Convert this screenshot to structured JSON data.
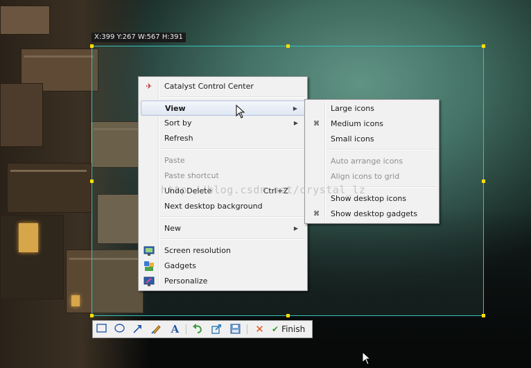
{
  "selection": {
    "coordinates": "X:399 Y:267 W:567 H:391"
  },
  "context_menu": {
    "items": [
      {
        "label": "Catalyst Control Center",
        "icon": "catalyst-icon"
      },
      {
        "label": "View",
        "submenu": true,
        "highlighted": true
      },
      {
        "label": "Sort by",
        "submenu": true
      },
      {
        "label": "Refresh"
      },
      {
        "label": "Paste",
        "disabled": true
      },
      {
        "label": "Paste shortcut",
        "disabled": true
      },
      {
        "label": "Undo Delete",
        "shortcut": "Ctrl+Z"
      },
      {
        "label": "Next desktop background"
      },
      {
        "label": "New",
        "submenu": true
      },
      {
        "label": "Screen resolution",
        "icon": "monitor-icon"
      },
      {
        "label": "Gadgets",
        "icon": "gadgets-icon"
      },
      {
        "label": "Personalize",
        "icon": "personalize-icon"
      }
    ]
  },
  "view_submenu": {
    "items": [
      {
        "label": "Large icons"
      },
      {
        "label": "Medium icons",
        "checked": true
      },
      {
        "label": "Small icons"
      },
      {
        "label": "Auto arrange icons",
        "disabled": true
      },
      {
        "label": "Align icons to grid",
        "disabled": true
      },
      {
        "label": "Show desktop icons"
      },
      {
        "label": "Show desktop gadgets",
        "checked": true
      }
    ]
  },
  "watermark": "http://blog.csdn.net/crystal_lz",
  "toolbar": {
    "tools": [
      "rectangle-icon",
      "ellipse-icon",
      "arrow-icon",
      "brush-icon",
      "text-icon",
      "undo-icon",
      "export-icon",
      "save-icon",
      "cancel-icon"
    ],
    "finish_label": "Finish"
  },
  "colors": {
    "selection_border": "#33c4bb",
    "handle": "#ffe000",
    "menu_bg": "#f1f1f1"
  }
}
